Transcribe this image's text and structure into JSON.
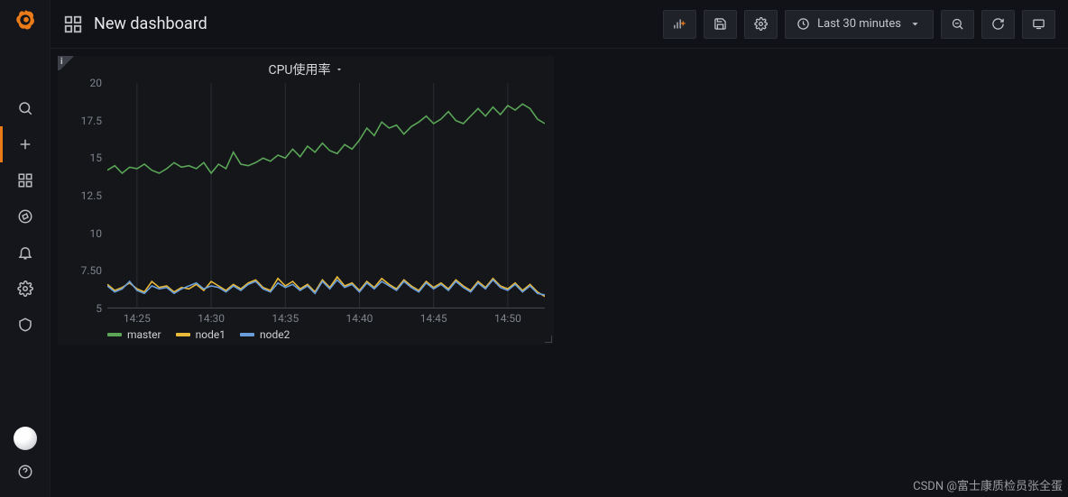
{
  "header": {
    "title": "New dashboard",
    "time_range_label": "Last 30 minutes"
  },
  "panel": {
    "title": "CPU使用率"
  },
  "legend": {
    "master": "master",
    "node1": "node1",
    "node2": "node2"
  },
  "watermark": "CSDN @富士康质检员张全蛋",
  "colors": {
    "master": "#5aa557",
    "node1": "#e9b93a",
    "node2": "#6a9edb",
    "grid": "#2a2d33",
    "axis": "#454852"
  },
  "chart_data": {
    "type": "line",
    "title": "CPU使用率",
    "xlabel": "",
    "ylabel": "",
    "ylim": [
      5,
      20
    ],
    "y_ticks": [
      5,
      7.5,
      10,
      12.5,
      15,
      17.5,
      20
    ],
    "x_ticks": [
      "14:25",
      "14:30",
      "14:35",
      "14:40",
      "14:45",
      "14:50"
    ],
    "x": [
      "14:23",
      "14:23:30",
      "14:24",
      "14:24:30",
      "14:25",
      "14:25:30",
      "14:26",
      "14:26:30",
      "14:27",
      "14:27:30",
      "14:28",
      "14:28:30",
      "14:29",
      "14:29:30",
      "14:30",
      "14:30:30",
      "14:31",
      "14:31:30",
      "14:32",
      "14:32:30",
      "14:33",
      "14:33:30",
      "14:34",
      "14:34:30",
      "14:35",
      "14:35:30",
      "14:36",
      "14:36:30",
      "14:37",
      "14:37:30",
      "14:38",
      "14:38:30",
      "14:39",
      "14:39:30",
      "14:40",
      "14:40:30",
      "14:41",
      "14:41:30",
      "14:42",
      "14:42:30",
      "14:43",
      "14:43:30",
      "14:44",
      "14:44:30",
      "14:45",
      "14:45:30",
      "14:46",
      "14:46:30",
      "14:47",
      "14:47:30",
      "14:48",
      "14:48:30",
      "14:49",
      "14:49:30",
      "14:50",
      "14:50:30",
      "14:51",
      "14:51:30",
      "14:52",
      "14:52:30"
    ],
    "series": [
      {
        "name": "master",
        "color": "#5aa557",
        "values": [
          14.2,
          14.5,
          14.0,
          14.4,
          14.3,
          14.6,
          14.2,
          14.0,
          14.3,
          14.7,
          14.4,
          14.5,
          14.3,
          14.7,
          14.0,
          14.6,
          14.3,
          15.4,
          14.6,
          14.5,
          14.7,
          15.0,
          14.8,
          15.2,
          15.0,
          15.6,
          15.1,
          15.8,
          15.4,
          16.0,
          15.5,
          15.3,
          15.9,
          15.6,
          16.2,
          17.0,
          16.5,
          17.4,
          17.0,
          17.2,
          16.6,
          17.1,
          17.4,
          17.8,
          17.3,
          17.6,
          18.1,
          17.5,
          17.3,
          17.8,
          18.3,
          17.8,
          18.4,
          17.9,
          18.5,
          18.2,
          18.6,
          18.3,
          17.6,
          17.3
        ]
      },
      {
        "name": "node1",
        "color": "#e9b93a",
        "values": [
          6.6,
          6.2,
          6.4,
          6.7,
          6.3,
          6.1,
          6.8,
          6.4,
          6.5,
          6.1,
          6.4,
          6.3,
          6.6,
          6.2,
          6.8,
          6.5,
          6.2,
          6.6,
          6.3,
          6.7,
          6.9,
          6.4,
          6.2,
          7.0,
          6.5,
          6.8,
          6.3,
          6.6,
          6.1,
          6.9,
          6.4,
          7.1,
          6.5,
          6.7,
          6.2,
          6.8,
          6.4,
          7.0,
          6.6,
          6.3,
          6.9,
          6.5,
          6.2,
          6.8,
          6.4,
          6.7,
          6.3,
          6.9,
          6.5,
          6.2,
          6.8,
          6.4,
          7.0,
          6.5,
          6.3,
          6.7,
          6.2,
          6.6,
          6.1,
          5.8
        ]
      },
      {
        "name": "node2",
        "color": "#6a9edb",
        "values": [
          6.5,
          6.1,
          6.3,
          6.8,
          6.2,
          6.0,
          6.5,
          6.3,
          6.4,
          6.0,
          6.3,
          6.5,
          6.7,
          6.3,
          6.5,
          6.4,
          6.1,
          6.5,
          6.2,
          6.6,
          6.8,
          6.3,
          6.1,
          6.7,
          6.4,
          6.6,
          6.2,
          6.5,
          6.0,
          6.8,
          6.3,
          6.9,
          6.4,
          6.6,
          6.1,
          6.7,
          6.3,
          6.8,
          6.5,
          6.2,
          6.8,
          6.4,
          6.1,
          6.7,
          6.3,
          6.6,
          6.2,
          6.8,
          6.4,
          6.1,
          6.7,
          6.3,
          6.9,
          6.4,
          6.2,
          6.6,
          6.1,
          6.5,
          6.0,
          5.9
        ]
      }
    ]
  }
}
